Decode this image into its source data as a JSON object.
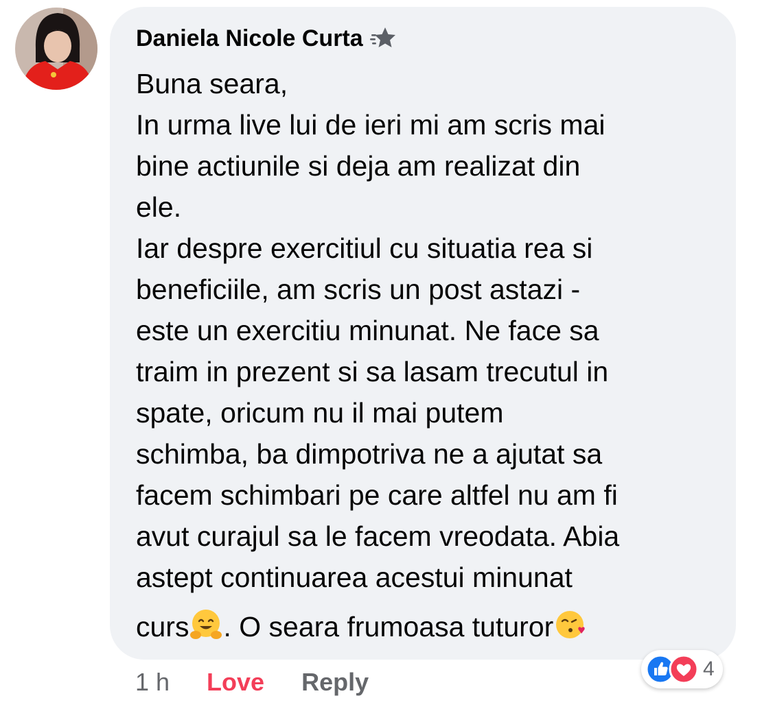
{
  "comment": {
    "author": "Daniela Nicole Curta",
    "lines": [
      "Buna seara,",
      "In urma live lui de ieri mi am scris mai",
      "bine actiunile si deja am realizat din",
      "ele.",
      "Iar despre exercitiul cu situatia rea si",
      "beneficiile, am scris un post astazi -",
      "este un exercitiu minunat. Ne face sa",
      "traim in prezent si sa lasam trecutul in",
      "spate, oricum nu il mai putem",
      "schimba, ba dimpotriva ne a ajutat sa",
      "facem schimbari pe care altfel nu am fi",
      "avut curajul sa le facem vreodata. Abia",
      "astept continuarea acestui minunat"
    ],
    "last_line": {
      "part1": "curs",
      "emoji1": "hugging-face",
      "part2": ". O seara frumoasa tuturor",
      "emoji2": "face-blowing-kiss"
    }
  },
  "actions": {
    "timestamp": "1 h",
    "love_label": "Love",
    "reply_label": "Reply"
  },
  "reactions": {
    "types": [
      "like",
      "love"
    ],
    "count": "4"
  },
  "colors": {
    "bubble_bg": "#f0f2f5",
    "love": "#f33e58",
    "meta_text": "#65676b",
    "like_blue": "#1877f2"
  }
}
